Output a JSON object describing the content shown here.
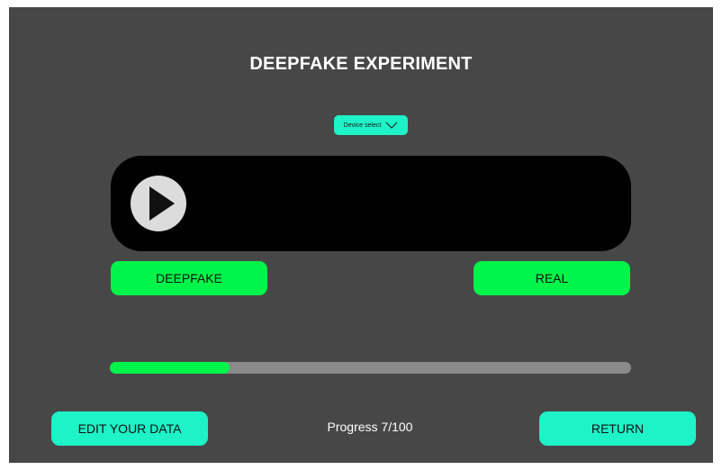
{
  "header": {
    "title": "DEEPFAKE EXPERIMENT"
  },
  "device_select": {
    "label": "Device select",
    "icon": "chevron-down-icon"
  },
  "player": {
    "play_icon": "play-icon"
  },
  "choices": {
    "deepfake_label": "DEEPFAKE",
    "real_label": "REAL"
  },
  "progress": {
    "current": 7,
    "total": 100,
    "fraction": 0.23,
    "text": "Progress 7/100"
  },
  "footer": {
    "edit_label": "EDIT YOUR DATA",
    "return_label": "RETURN"
  },
  "colors": {
    "background": "#474747",
    "accent_green": "#00f54a",
    "accent_teal": "#1ef2c7",
    "player_bg": "#000000",
    "track": "#8a8a8a"
  }
}
